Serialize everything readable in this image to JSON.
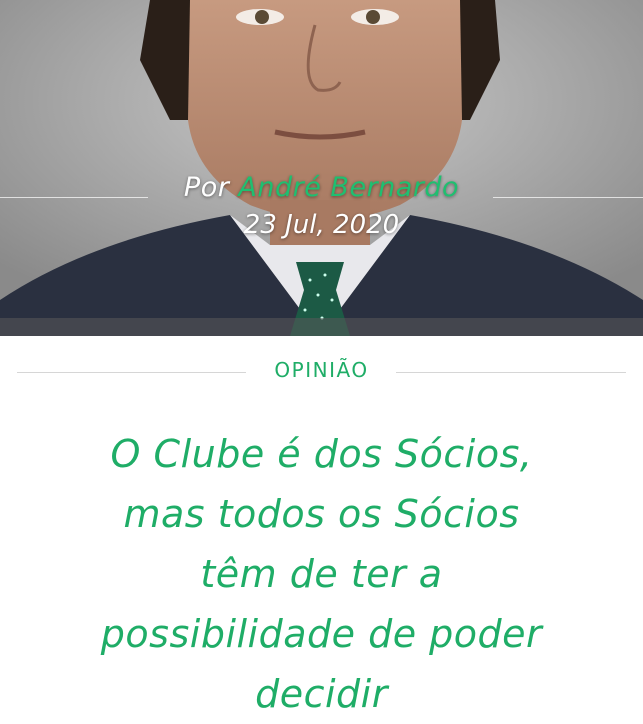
{
  "article": {
    "byline_prefix": "Por",
    "author": "André Bernardo",
    "date": "23 Jul, 2020",
    "category": "OPINIÃO",
    "title_lines": [
      "O Clube é dos Sócios,",
      "mas todos os Sócios",
      "têm de ter a",
      "possibilidade de poder",
      "decidir"
    ]
  },
  "colors": {
    "accent": "#1fad67",
    "byline_author": "#1fbf70",
    "divider": "#d6d6d6"
  }
}
